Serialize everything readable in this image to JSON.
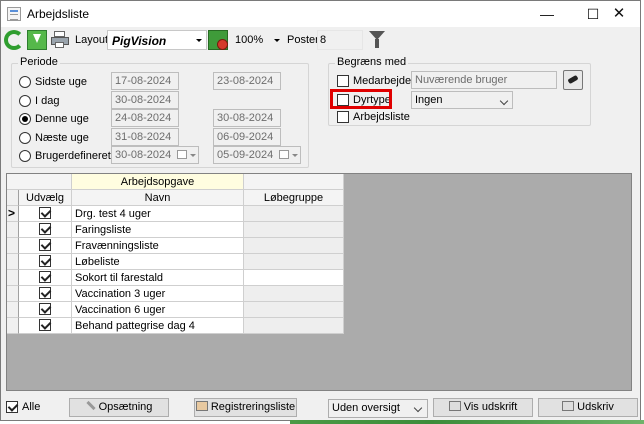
{
  "window": {
    "title": "Arbejdsliste",
    "minimize": "—",
    "maximize": "☐",
    "close": "✕"
  },
  "toolbar": {
    "layout_label": "Layout",
    "layout_value": "PigVision",
    "zoom_value": "100%",
    "poster_label": "Poster",
    "poster_value": "8"
  },
  "periode": {
    "legend": "Periode",
    "options": [
      {
        "label": "Sidste uge",
        "from": "17-08-2024",
        "to": "23-08-2024",
        "selected": false
      },
      {
        "label": "I dag",
        "from": "30-08-2024",
        "to": "",
        "selected": false
      },
      {
        "label": "Denne uge",
        "from": "24-08-2024",
        "to": "30-08-2024",
        "selected": true
      },
      {
        "label": "Næste uge",
        "from": "31-08-2024",
        "to": "06-09-2024",
        "selected": false
      },
      {
        "label": "Brugerdefineret",
        "from": "30-08-2024",
        "to": "05-09-2024",
        "selected": false
      }
    ]
  },
  "begraens": {
    "legend": "Begræns med",
    "medarbejder_label": "Medarbejder",
    "medarbejder_value": "Nuværende bruger",
    "dyrtype_label": "Dyrtype",
    "dyrtype_value": "Ingen",
    "arbejdsliste_label": "Arbejdsliste"
  },
  "grid": {
    "group_header": "Arbejdsopgave",
    "col_udvaelg": "Udvælg",
    "col_navn": "Navn",
    "col_lobegruppe": "Løbegruppe",
    "rows": [
      {
        "navn": "Drg. test 4 uger",
        "checked": true
      },
      {
        "navn": "Faringsliste",
        "checked": true
      },
      {
        "navn": "Fravænningsliste",
        "checked": true
      },
      {
        "navn": "Løbeliste",
        "checked": true
      },
      {
        "navn": "Sokort til farestald",
        "checked": true
      },
      {
        "navn": "Vaccination 3 uger",
        "checked": true
      },
      {
        "navn": "Vaccination 6 uger",
        "checked": true
      },
      {
        "navn": "Behand pattegrise dag 4",
        "checked": true
      }
    ]
  },
  "bottom": {
    "alle_label": "Alle",
    "opsaetning": "Opsætning",
    "registreringsliste": "Registreringsliste",
    "oversigt_value": "Uden oversigt",
    "vis_udskrift": "Vis udskrift",
    "udskriv": "Udskriv"
  },
  "colors": {
    "accent_green": "#2f9e2f",
    "highlight_red": "#e00000",
    "header_yellow": "#fffde0"
  }
}
